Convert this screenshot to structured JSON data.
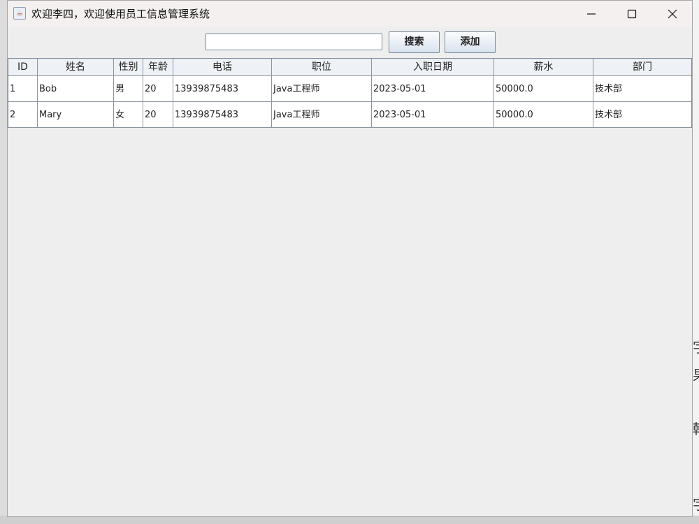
{
  "window": {
    "title": "欢迎李四，欢迎使用员工信息管理系统",
    "icon": "java-icon"
  },
  "toolbar": {
    "search_value": "",
    "search_label": "搜索",
    "add_label": "添加"
  },
  "table": {
    "columns": [
      "ID",
      "姓名",
      "性别",
      "年龄",
      "电话",
      "职位",
      "入职日期",
      "薪水",
      "部门"
    ],
    "rows": [
      [
        "1",
        "Bob",
        "男",
        "20",
        "13939875483",
        "Java工程师",
        "2023-05-01",
        "50000.0",
        "技术部"
      ],
      [
        "2",
        "Mary",
        "女",
        "20",
        "13939875483",
        "Java工程师",
        "2023-05-01",
        "50000.0",
        "技术部"
      ]
    ]
  },
  "background_window": {
    "glyphs": [
      "字",
      "果",
      "韩",
      "字"
    ]
  }
}
